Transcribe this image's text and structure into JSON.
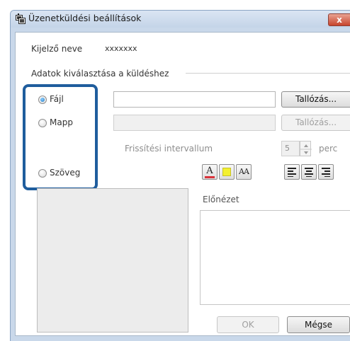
{
  "window": {
    "title": "Üzenetküldési beállítások",
    "close_label": "x"
  },
  "display_name": {
    "label": "Kijelző neve",
    "value": "xxxxxxx"
  },
  "group": {
    "title": "Adatok kiválasztása a küldéshez",
    "file": {
      "label": "Fájl",
      "selected": true,
      "value": "",
      "browse": "Tallózás..."
    },
    "folder": {
      "label": "Mapp",
      "selected": false,
      "value": "",
      "browse": "Tallózás..."
    },
    "refresh": {
      "label": "Frissítési intervallum",
      "value": "5",
      "unit": "perc"
    },
    "text": {
      "label": "Szöveg",
      "selected": false
    }
  },
  "format_toolbar": {
    "font_color": "A",
    "font_size": "AA",
    "font_color_swatch": "#d9323a",
    "bg_color_swatch": "#f3f030"
  },
  "preview": {
    "label": "Előnézet"
  },
  "footer": {
    "ok": "OK",
    "cancel": "Mégse"
  }
}
